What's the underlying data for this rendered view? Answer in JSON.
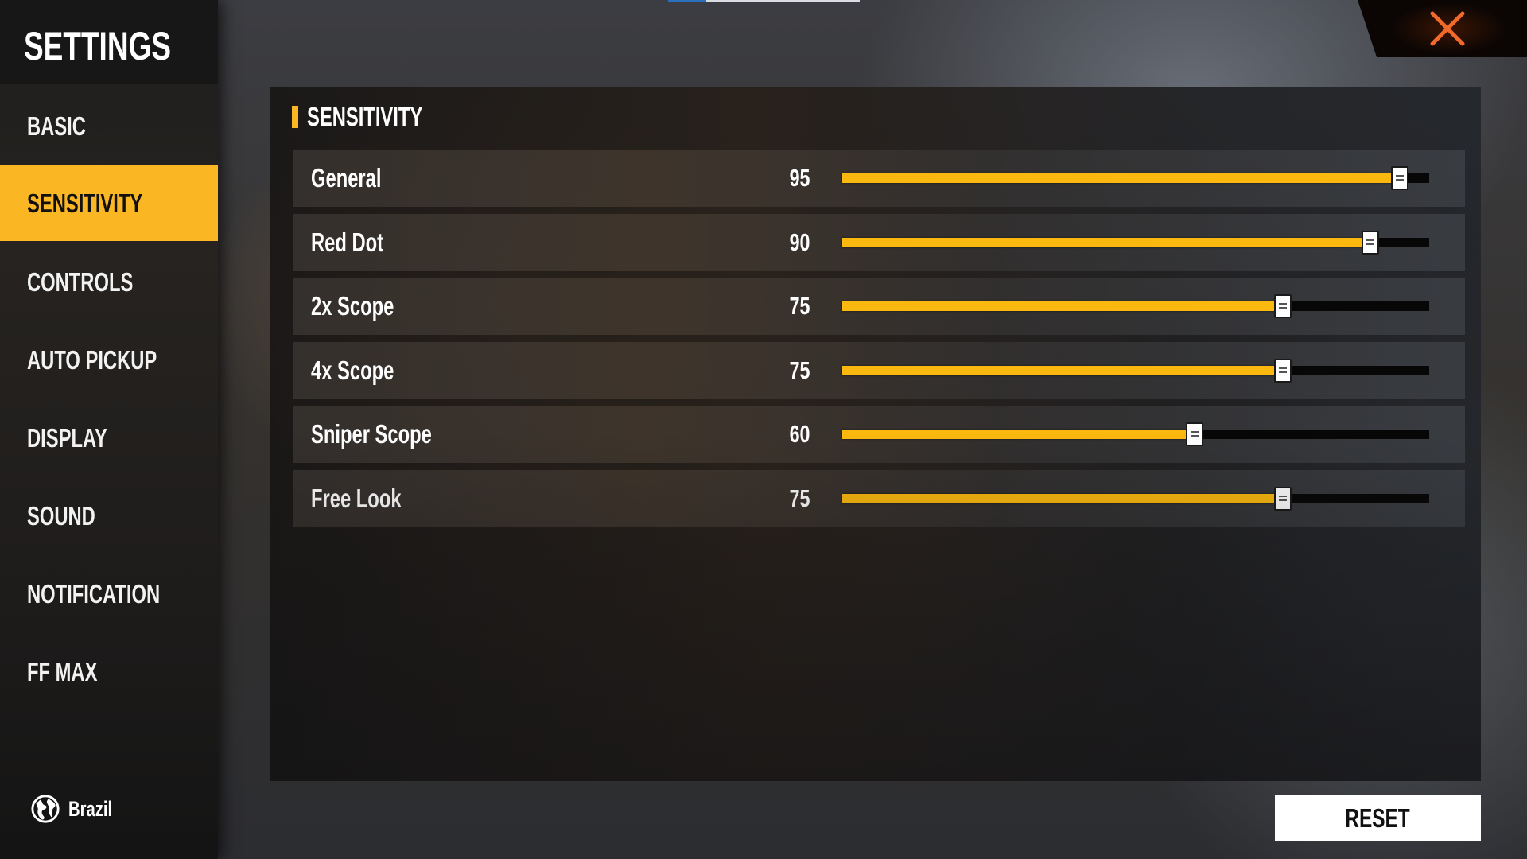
{
  "top_progress": {
    "percent": 20,
    "colors": {
      "fill": "#2d6fbf",
      "track": "#d9dde3"
    }
  },
  "sidebar": {
    "title": "SETTINGS",
    "active_index": 1,
    "items": [
      {
        "label": "BASIC"
      },
      {
        "label": "SENSITIVITY"
      },
      {
        "label": "CONTROLS"
      },
      {
        "label": "AUTO PICKUP"
      },
      {
        "label": "DISPLAY"
      },
      {
        "label": "SOUND"
      },
      {
        "label": "NOTIFICATION"
      },
      {
        "label": "FF MAX"
      }
    ],
    "region": {
      "icon": "globe-icon",
      "label": "Brazil"
    }
  },
  "close": {
    "icon": "close-icon",
    "color": "#f26a2a"
  },
  "panel": {
    "section_title": "SENSITIVITY",
    "accent": "#fbb623",
    "settings": [
      {
        "label": "General",
        "value": "95",
        "percent": 95
      },
      {
        "label": "Red Dot",
        "value": "90",
        "percent": 90
      },
      {
        "label": "2x Scope",
        "value": "75",
        "percent": 75
      },
      {
        "label": "4x Scope",
        "value": "75",
        "percent": 75
      },
      {
        "label": "Sniper Scope",
        "value": "60",
        "percent": 60
      },
      {
        "label": "Free Look",
        "value": "75",
        "percent": 75
      }
    ]
  },
  "reset_label": "RESET"
}
